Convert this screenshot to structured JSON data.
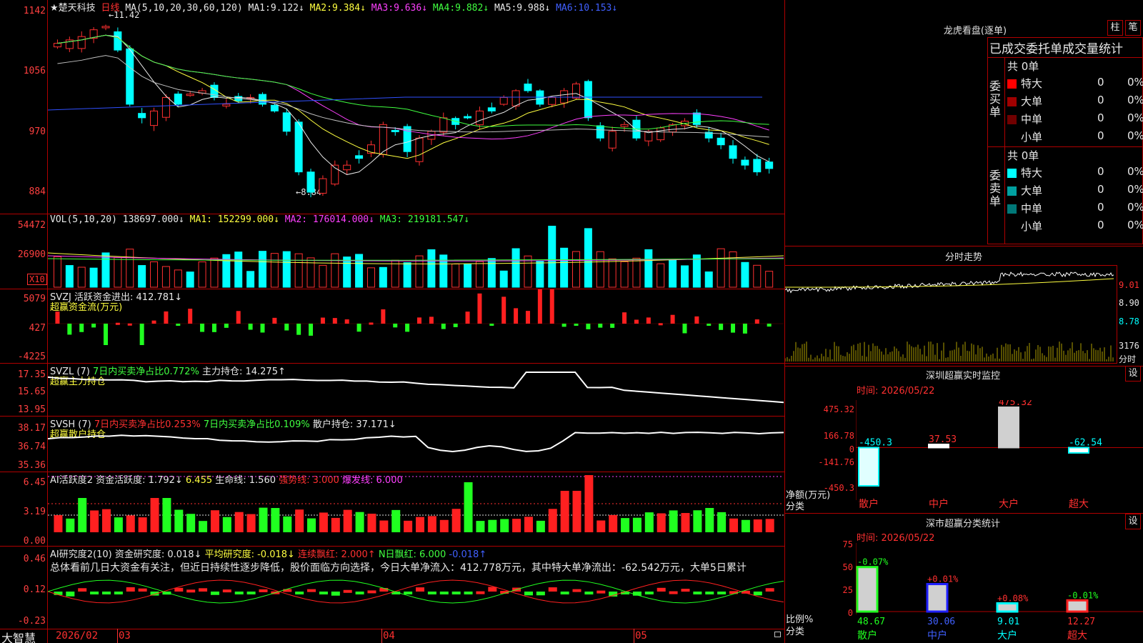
{
  "stock": {
    "name": "★楚天科技",
    "period": "日线",
    "ma_params": "MA(5,10,20,30,60,120)",
    "ma": [
      {
        "label": "MA1:",
        "value": "9.122↓"
      },
      {
        "label": "MA2:",
        "value": "9.384↓"
      },
      {
        "label": "MA3:",
        "value": "9.636↓"
      },
      {
        "label": "MA4:",
        "value": "9.882↓"
      },
      {
        "label": "MA5:",
        "value": "9.988↓"
      },
      {
        "label": "MA6:",
        "value": "10.153↓"
      }
    ],
    "high_mark": "←11.42",
    "low_mark": "←8.84"
  },
  "price_axis": [
    "1142",
    "1056",
    "970",
    "884"
  ],
  "vol": {
    "header": "VOL(5,10,20)",
    "value": "138697.000↓",
    "ma1": "MA1: 152299.000↓",
    "ma2": "MA2: 176014.000↓",
    "ma3": "MA3: 219181.547↓",
    "axis": [
      "54472",
      "26900"
    ],
    "unit": "X10"
  },
  "svzj": {
    "header": "SVZJ  活跃资金进出: 412.781↓",
    "sub": "超赢资金流(万元)",
    "axis": [
      "5079",
      "427",
      "-4225"
    ]
  },
  "svzl": {
    "header": "SVZL (7)",
    "p1": "7日内买卖净占比0.772%",
    "p2": "主力持仓: 14.275↑",
    "sub": "超赢主力持仓",
    "axis": [
      "17.35",
      "15.65",
      "13.95"
    ]
  },
  "svsh": {
    "header": "SVSH (7)",
    "p1": "7日内买卖净占比0.253%",
    "p2": "7日内买卖净占比0.109%",
    "p3": "散户持仓: 37.171↓",
    "sub": "超赢散户持仓",
    "axis": [
      "38.17",
      "36.74",
      "35.36"
    ]
  },
  "ai2": {
    "header": "AI活跃度2",
    "p1": "资金活跃度: 1.792↓",
    "p2": "6.455",
    "p3": "生命线: 1.560",
    "p4": "强势线: 3.000",
    "p5": "爆发线: 6.000",
    "axis": [
      "6.45",
      "3.19",
      "0.00"
    ]
  },
  "ai_res": {
    "header": "AI研究度2(10)",
    "p1": "资金研究度: 0.018↓",
    "p2": "平均研究度: -0.018↓",
    "p3": "连续飘红: 2.000↑",
    "p4": "N日飘红: 6.000",
    "p5": "-0.018↑",
    "text": "总体看前几日大资金有关注，但近日持续性逐步降低，股价面临方向选择，今日大单净流入：412.778万元，其中特大单净流出：-62.542万元，大单5日累计",
    "axis": [
      "0.46",
      "0.12",
      "-0.23"
    ]
  },
  "bottom": {
    "logo": "大智慧",
    "dates": [
      "2026/02",
      "03",
      "04",
      "05"
    ]
  },
  "lhb": {
    "title": "龙虎看盘(逐单)",
    "btn1": "柱",
    "btn2": "笔",
    "header": "已成交委托单成交量统计",
    "buy": {
      "side": "委买单",
      "total": "共 0单",
      "rows": [
        {
          "name": "特大",
          "color": "#ff0000",
          "val": "0",
          "pct": "0%"
        },
        {
          "name": "大单",
          "color": "#a00000",
          "val": "0",
          "pct": "0%"
        },
        {
          "name": "中单",
          "color": "#700000",
          "val": "0",
          "pct": "0%"
        },
        {
          "name": "小单",
          "color": "#000000",
          "val": "0",
          "pct": "0%"
        }
      ]
    },
    "sell": {
      "side": "委卖单",
      "total": "共 0单",
      "rows": [
        {
          "name": "特大",
          "color": "#00ffff",
          "val": "0",
          "pct": "0%"
        },
        {
          "name": "大单",
          "color": "#00a0a0",
          "val": "0",
          "pct": "0%"
        },
        {
          "name": "中单",
          "color": "#007878",
          "val": "0",
          "pct": "0%"
        },
        {
          "name": "小单",
          "color": "#000000",
          "val": "0",
          "pct": "0%"
        }
      ]
    }
  },
  "fenshi": {
    "title": "分时走势",
    "axis": [
      "9.01",
      "8.90",
      "8.78",
      "3176",
      "分时"
    ]
  },
  "monitor": {
    "title": "深圳超赢实时监控",
    "btn": "设",
    "time": "时间: 2026/05/22",
    "axis": [
      "475.32",
      "166.78",
      "0",
      "-141.76",
      "-450.3"
    ],
    "ylabel": "净额(万元)",
    "xlabel": "分类",
    "cats": [
      "散户",
      "中户",
      "大户",
      "超大"
    ],
    "values": [
      "-450.3",
      "37.53",
      "475.32",
      "-62.54"
    ]
  },
  "stats": {
    "title": "深市超赢分类统计",
    "btn": "设",
    "time": "时间: 2026/05/22",
    "axis": [
      "75",
      "50",
      "25",
      "0"
    ],
    "ylabel": "比例%",
    "xlabel": "分类",
    "cats": [
      "散户",
      "中户",
      "大户",
      "超大"
    ],
    "pct": [
      "-0.07%",
      "+0.01%",
      "+0.08%",
      "-0.01%"
    ],
    "vals": [
      "48.67",
      "30.06",
      "9.01",
      "12.27"
    ]
  },
  "chart_data": [
    {
      "type": "bar",
      "title": "深圳超赢实时监控",
      "categories": [
        "散户",
        "中户",
        "大户",
        "超大"
      ],
      "values": [
        -450.3,
        37.53,
        475.32,
        -62.54
      ],
      "ylabel": "净额(万元)",
      "ylim": [
        -450.3,
        475.32
      ]
    },
    {
      "type": "bar",
      "title": "深市超赢分类统计",
      "categories": [
        "散户",
        "中户",
        "大户",
        "超大"
      ],
      "values": [
        48.67,
        30.06,
        9.01,
        12.27
      ],
      "ylabel": "比例%",
      "ylim": [
        0,
        75
      ]
    }
  ]
}
